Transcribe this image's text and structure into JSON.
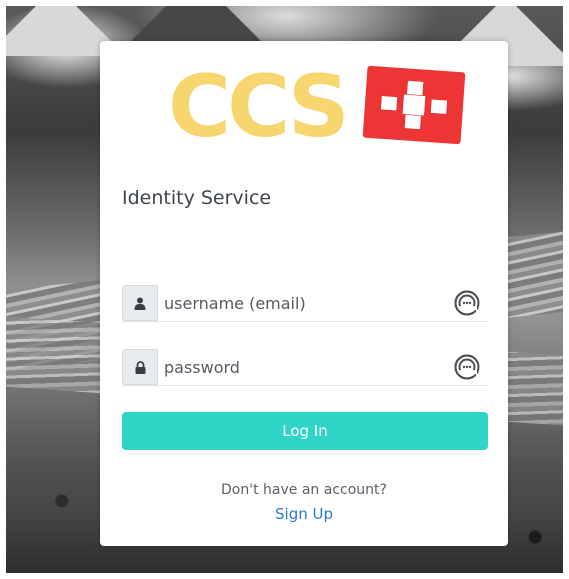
{
  "logo": {
    "text": "CCS",
    "text_color": "#f7d66f",
    "flag_color": "#ee3535"
  },
  "service_title": "Identity Service",
  "username": {
    "placeholder": "username (email)",
    "value": "",
    "icon": "user-icon"
  },
  "password": {
    "placeholder": "password",
    "value": "",
    "icon": "lock-icon"
  },
  "password_manager_icon": "password-manager-icon",
  "login_button": {
    "label": "Log In",
    "color": "#2fd6c8"
  },
  "signup_prompt": "Don't have an account?",
  "signup_link": {
    "label": "Sign Up",
    "color": "#2979c9"
  }
}
